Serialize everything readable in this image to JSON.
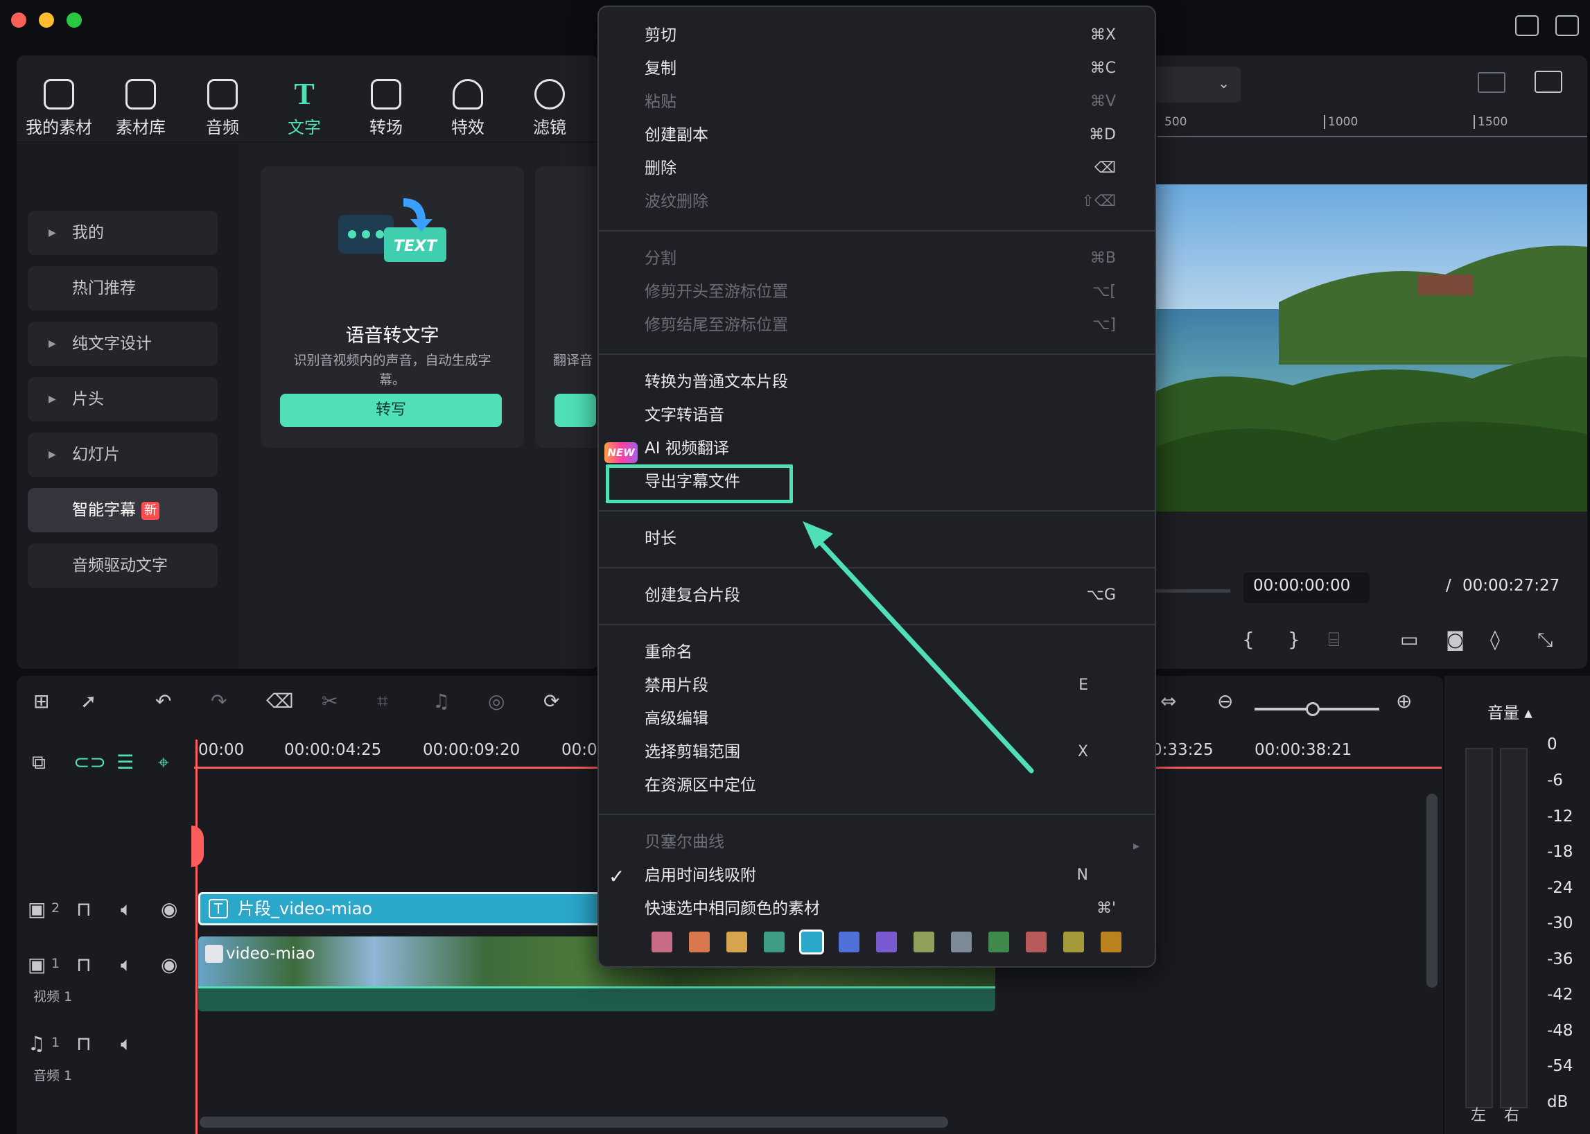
{
  "media_panel": {
    "tabs": [
      {
        "label": "我的素材",
        "icon": "my-media-icon"
      },
      {
        "label": "素材库",
        "icon": "store-icon"
      },
      {
        "label": "音频",
        "icon": "music-note-icon"
      },
      {
        "label": "文字",
        "icon": "text-icon"
      },
      {
        "label": "转场",
        "icon": "transition-icon"
      },
      {
        "label": "特效",
        "icon": "effects-icon"
      },
      {
        "label": "滤镜",
        "icon": "filter-icon"
      }
    ],
    "sidebar": [
      {
        "label": "我的"
      },
      {
        "label": "热门推荐"
      },
      {
        "label": "纯文字设计"
      },
      {
        "label": "片头"
      },
      {
        "label": "幻灯片"
      },
      {
        "label": "智能字幕",
        "badge": "新"
      },
      {
        "label": "音频驱动文字"
      }
    ],
    "cards": [
      {
        "title": "语音转文字",
        "desc": "识别音视频内的声音，自动生成字幕。",
        "button": "转写",
        "art_text": "TEXT"
      },
      {
        "desc": "翻译音"
      }
    ]
  },
  "preview": {
    "ruler_labels": [
      "500",
      "1000",
      "1500"
    ],
    "current_time": "00:00:00:00",
    "separator": "/",
    "total_time": "00:00:27:27"
  },
  "timeline": {
    "ruler_labels": [
      "00:00",
      "00:00:04:25",
      "00:00:09:20",
      "00:0",
      "0:33:25",
      "00:00:38:21"
    ],
    "tracks": {
      "text_track_number": "2",
      "video_track_number": "1",
      "video_track_label": "视频 1",
      "audio_track_number": "1",
      "audio_track_label": "音频 1"
    },
    "clips": {
      "text_clip": "片段_video-miao",
      "video_clip": "video-miao"
    }
  },
  "volume": {
    "title": "音量 ▴",
    "scale": [
      "0",
      "-6",
      "-12",
      "-18",
      "-24",
      "-30",
      "-36",
      "-42",
      "-48",
      "-54",
      "dB"
    ],
    "left": "左",
    "right": "右"
  },
  "context_menu": {
    "items": [
      {
        "label": "剪切",
        "shortcut": "⌘X",
        "enabled": true
      },
      {
        "label": "复制",
        "shortcut": "⌘C",
        "enabled": true
      },
      {
        "label": "粘贴",
        "shortcut": "⌘V",
        "enabled": false
      },
      {
        "label": "创建副本",
        "shortcut": "⌘D",
        "enabled": true
      },
      {
        "label": "删除",
        "shortcut": "⌫",
        "enabled": true
      },
      {
        "label": "波纹删除",
        "shortcut": "⇧⌫",
        "enabled": false
      },
      {
        "label": "分割",
        "shortcut": "⌘B",
        "enabled": false
      },
      {
        "label": "修剪开头至游标位置",
        "shortcut": "⌥[",
        "enabled": false
      },
      {
        "label": "修剪结尾至游标位置",
        "shortcut": "⌥]",
        "enabled": false
      },
      {
        "label": "转换为普通文本片段",
        "shortcut": "",
        "enabled": true
      },
      {
        "label": "文字转语音",
        "shortcut": "",
        "enabled": true
      },
      {
        "label": "AI 视频翻译",
        "shortcut": "",
        "enabled": true,
        "badge": "NEW"
      },
      {
        "label": "导出字幕文件",
        "shortcut": "",
        "enabled": true,
        "highlighted": true
      },
      {
        "label": "时长",
        "shortcut": "",
        "enabled": true
      },
      {
        "label": "创建复合片段",
        "shortcut": "⌥G",
        "enabled": true
      },
      {
        "label": "重命名",
        "shortcut": "",
        "enabled": true
      },
      {
        "label": "禁用片段",
        "shortcut": "E",
        "enabled": true
      },
      {
        "label": "高级编辑",
        "shortcut": "",
        "enabled": true
      },
      {
        "label": "选择剪辑范围",
        "shortcut": "X",
        "enabled": true
      },
      {
        "label": "在资源区中定位",
        "shortcut": "",
        "enabled": true
      },
      {
        "label": "贝塞尔曲线",
        "shortcut": "",
        "enabled": false,
        "submenu": true
      },
      {
        "label": "启用时间线吸附",
        "shortcut": "N",
        "enabled": true,
        "checked": true
      },
      {
        "label": "快速选中相同颜色的素材",
        "shortcut": "⌘'",
        "enabled": true
      }
    ],
    "color_swatches": [
      "#c86b86",
      "#d9774f",
      "#d6a44e",
      "#3f9d85",
      "#2aa7c9",
      "#4f70d6",
      "#7a5ad0",
      "#8fa05a",
      "#7c8a96",
      "#3f8a4a",
      "#b85a5a",
      "#a59a3a",
      "#b9821f"
    ],
    "selected_swatch_index": 4,
    "accent_color": "#4fe0b8"
  }
}
